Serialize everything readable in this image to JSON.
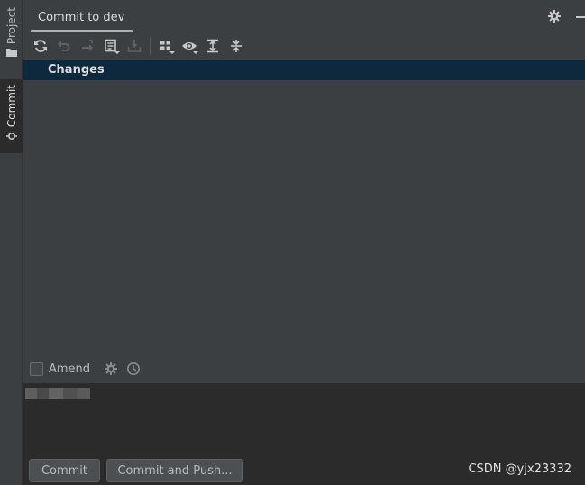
{
  "sidebar": {
    "tabs": [
      {
        "label": "Project",
        "icon": "folder-icon"
      },
      {
        "label": "Commit",
        "icon": "commit-icon"
      }
    ]
  },
  "header": {
    "title": "Commit to dev"
  },
  "toolbar": {
    "buttons": [
      {
        "icon": "refresh-icon",
        "enabled": true
      },
      {
        "icon": "rollback-icon",
        "enabled": false
      },
      {
        "icon": "move-changes-icon",
        "enabled": false
      },
      {
        "icon": "changelist-icon",
        "enabled": true
      },
      {
        "icon": "shelve-icon",
        "enabled": false
      },
      {
        "icon": "group-by-icon",
        "enabled": true
      },
      {
        "icon": "view-options-icon",
        "enabled": true
      },
      {
        "icon": "expand-all-icon",
        "enabled": true
      },
      {
        "icon": "collapse-all-icon",
        "enabled": true
      }
    ]
  },
  "changes": {
    "label": "Changes"
  },
  "amend": {
    "label": "Amend",
    "checked": false
  },
  "commit_message": {
    "value": ""
  },
  "actions": {
    "commit_label": "Commit",
    "commit_push_label": "Commit and Push..."
  },
  "watermark": "CSDN @yjx23332",
  "colors": {
    "panel_bg": "#3c3f41",
    "editor_bg": "#2b2b2b",
    "selection_bg": "#0d293e",
    "text": "#bbbbbb"
  }
}
